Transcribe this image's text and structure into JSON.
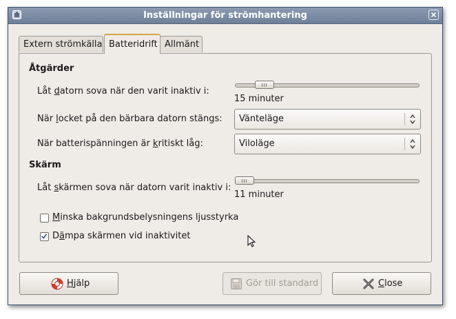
{
  "window": {
    "title": "Inställningar för strömhantering",
    "app_icon": "battery-icon",
    "close_icon": "close-icon"
  },
  "tabs": [
    {
      "label": "Extern strömkälla",
      "active": false
    },
    {
      "label": "Batteridrift",
      "active": true
    },
    {
      "label": "Allmänt",
      "active": false
    }
  ],
  "actions": {
    "heading": "Åtgärder",
    "sleep_label_pre": "Låt ",
    "sleep_label_mnemonic": "d",
    "sleep_label_post": "atorn sova när den varit inaktiv i:",
    "sleep_value": "15 minuter",
    "sleep_level": 0.12,
    "lid_label_pre": "När ",
    "lid_label_mnemonic": "l",
    "lid_label_post": "ocket på den bärbara datorn stängs:",
    "lid_value": "Vänteläge",
    "battery_label_pre": "När batterispänningen är ",
    "battery_label_mnemonic": "k",
    "battery_label_post": "ritiskt låg:",
    "battery_value": "Viloläge"
  },
  "screen": {
    "heading": "Skärm",
    "sleep_label_pre": "Låt ",
    "sleep_label_mnemonic": "s",
    "sleep_label_post": "kärmen sova när datorn varit inaktiv i:",
    "sleep_value": "11 minuter",
    "sleep_level": 0.0,
    "reduce_mnemonic": "M",
    "reduce_label": "inska bakgrundsbelysningens ljusstyrka",
    "reduce_checked": false,
    "dim_label_pre": "D",
    "dim_mnemonic": "ä",
    "dim_label_post": "mpa skärmen vid inaktivitet",
    "dim_checked": true
  },
  "buttons": {
    "help_mnemonic": "H",
    "help_label": "jälp",
    "help_icon": "help-lifebuoy-icon",
    "default_label": "Gör till standard",
    "default_icon": "save-icon",
    "close_mnemonic": "C",
    "close_label": "lose",
    "close_icon": "close-x-icon"
  },
  "colors": {
    "titlebar": "#7d8ca5",
    "window_bg": "#efebe7",
    "active_tab_accent": "#d9a34b",
    "check": "#1f3f7a"
  }
}
